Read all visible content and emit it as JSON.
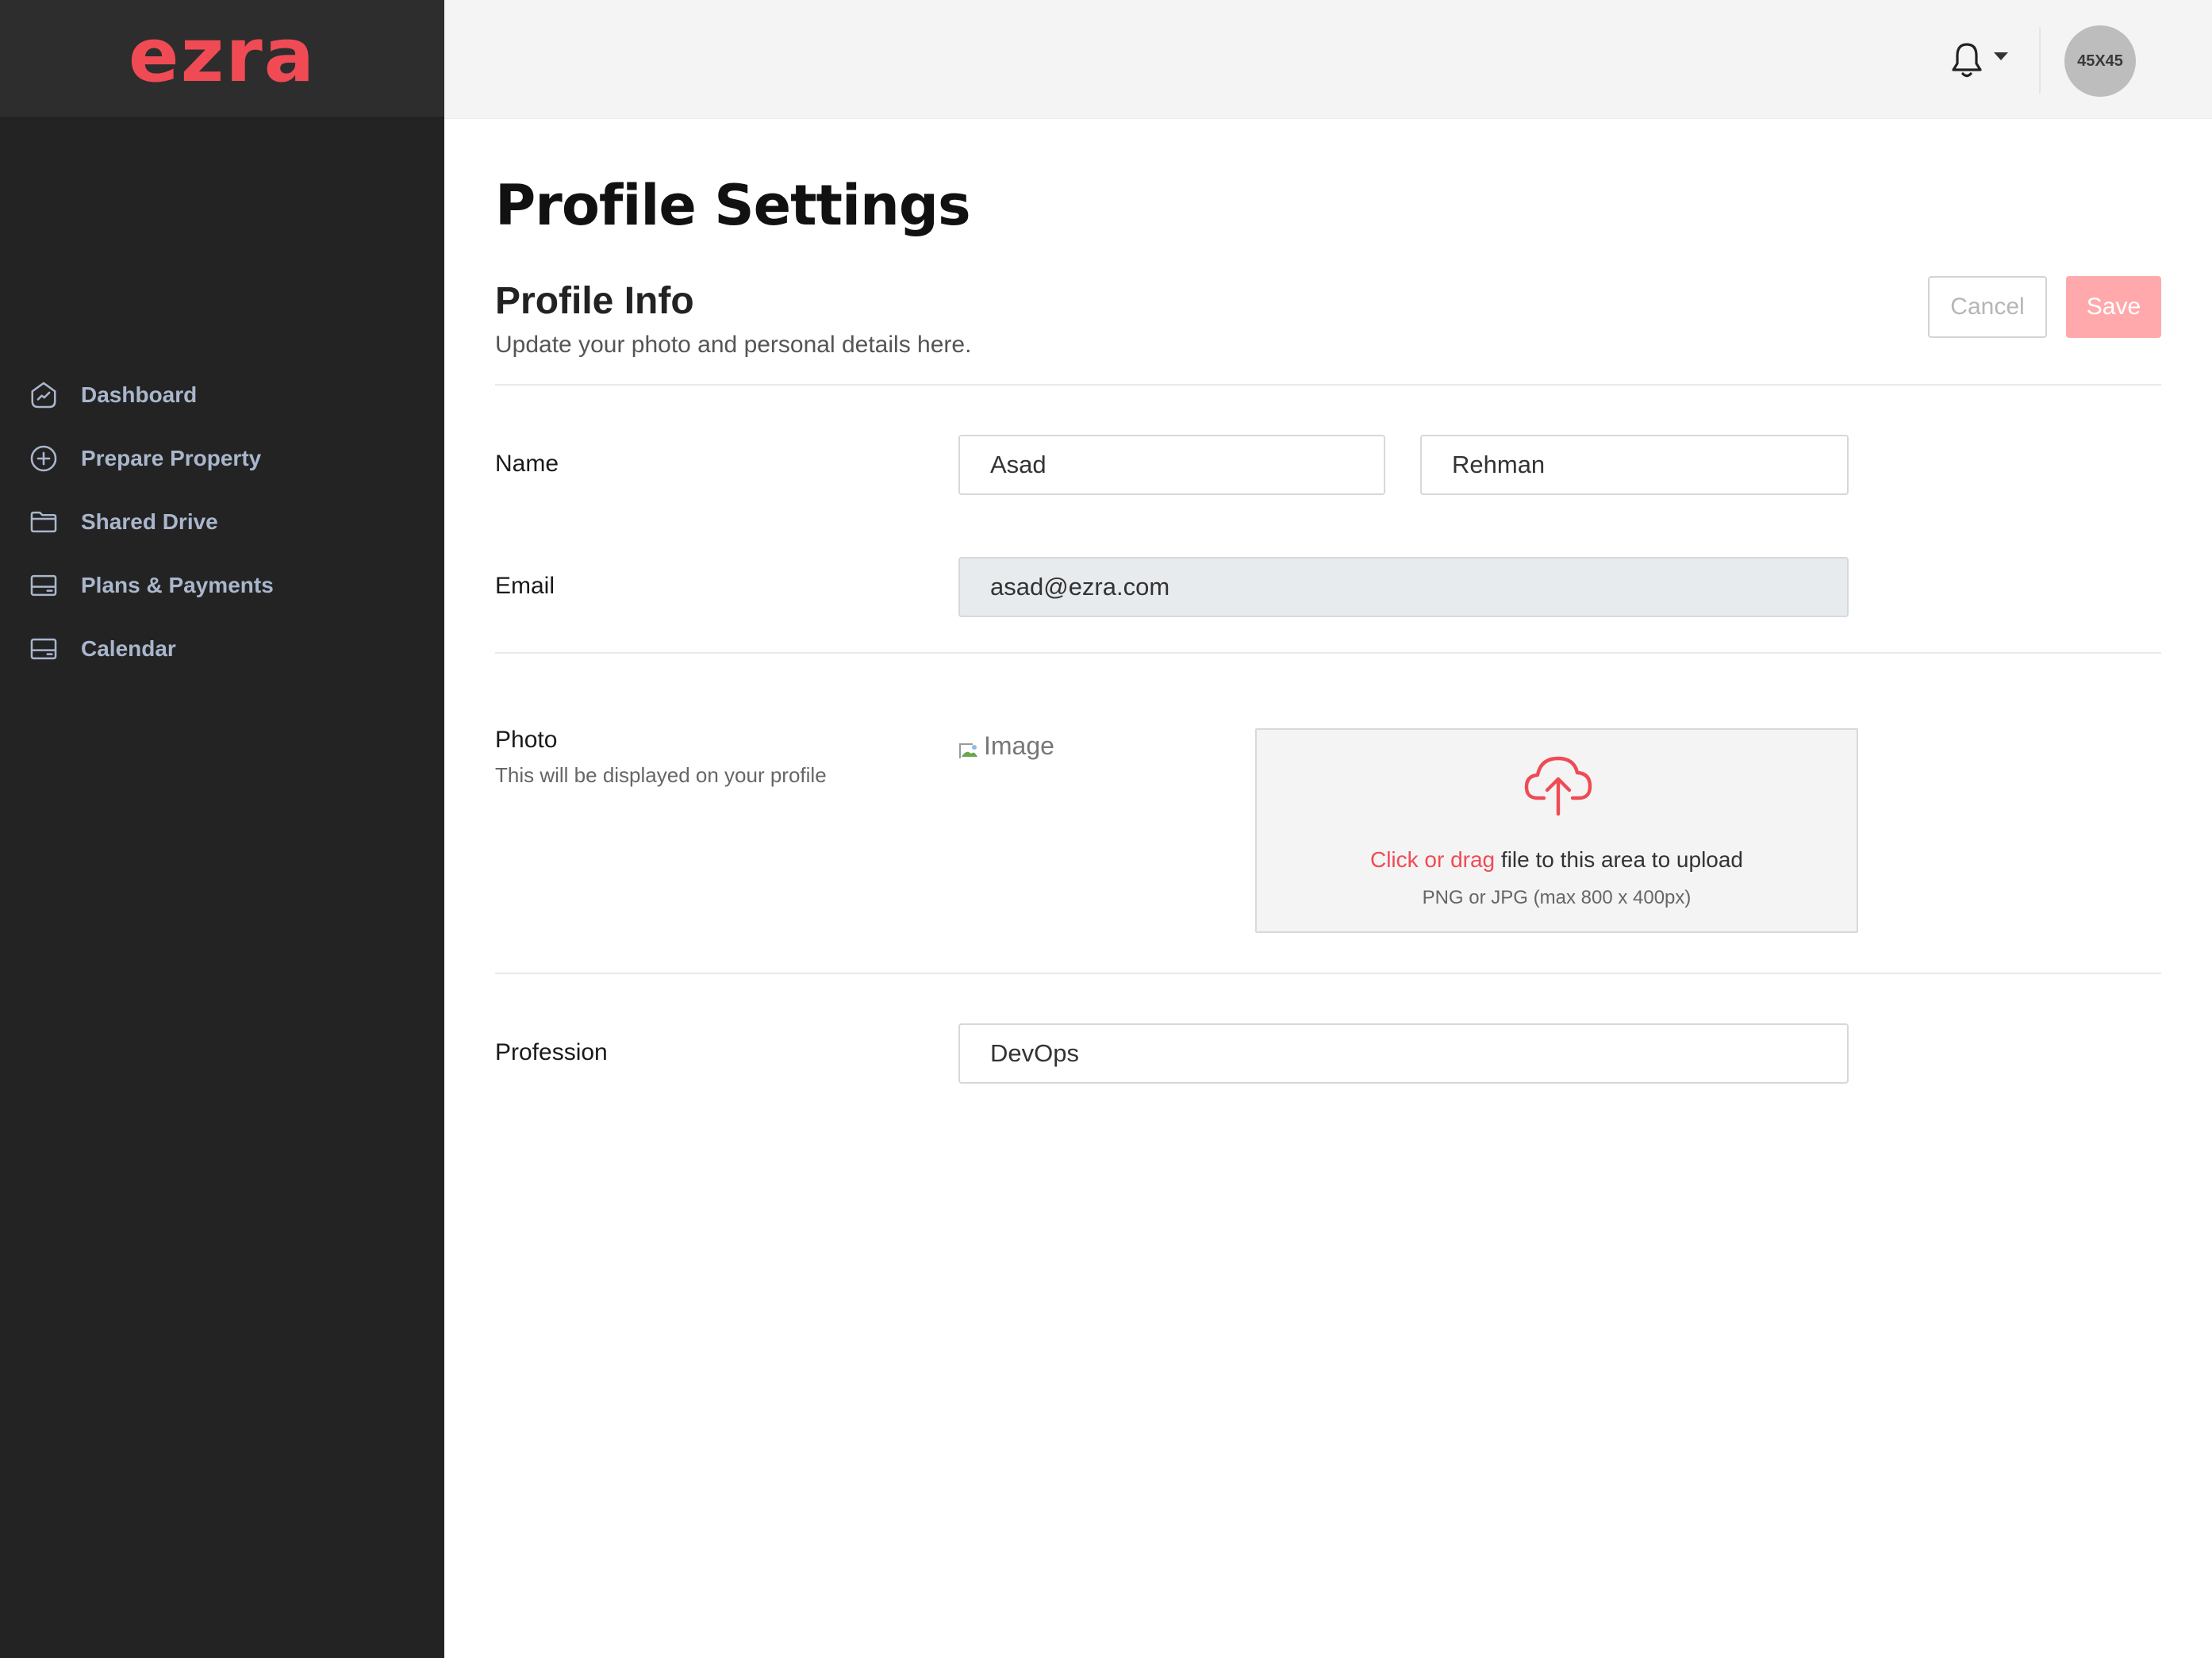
{
  "app": {
    "logo": "ezra",
    "brand_color": "#f04b55"
  },
  "sidebar": {
    "items": [
      {
        "label": "Dashboard",
        "icon": "chart-circle-icon"
      },
      {
        "label": "Prepare Property",
        "icon": "plus-circle-icon"
      },
      {
        "label": "Shared Drive",
        "icon": "folder-icon"
      },
      {
        "label": "Plans & Payments",
        "icon": "card-icon"
      },
      {
        "label": "Calendar",
        "icon": "card-icon"
      }
    ]
  },
  "topbar": {
    "avatar_text": "45X45",
    "notifications_icon": "bell-icon"
  },
  "page": {
    "title": "Profile Settings",
    "section_title": "Profile Info",
    "section_subtitle": "Update your photo and personal details here.",
    "cancel_label": "Cancel",
    "save_label": "Save"
  },
  "form": {
    "name_label": "Name",
    "first_name": "Asad",
    "last_name": "Rehman",
    "email_label": "Email",
    "email": "asad@ezra.com",
    "photo_label": "Photo",
    "photo_hint": "This will be displayed on your profile",
    "photo_alt": "Image",
    "upload_accent": "Click or drag",
    "upload_text": " file to this area to upload",
    "upload_hint": "PNG or JPG (max 800 x 400px)",
    "profession_label": "Profession",
    "profession": "DevOps"
  }
}
